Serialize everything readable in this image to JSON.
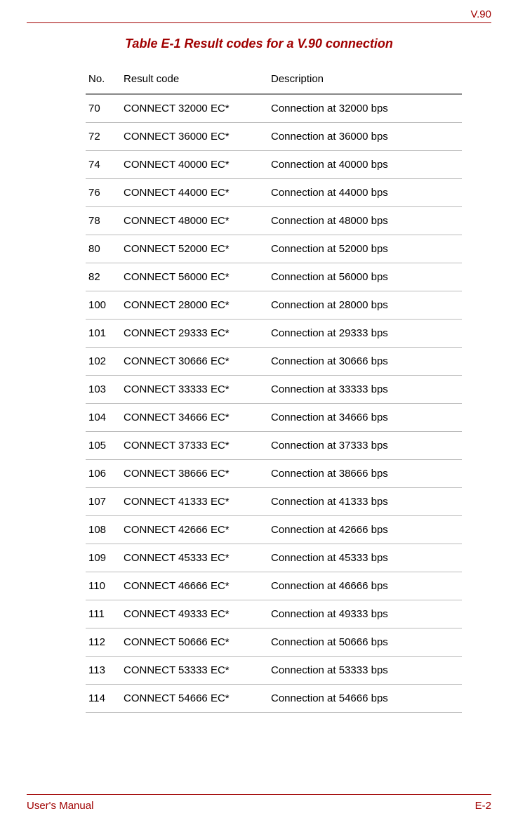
{
  "header": {
    "section": "V.90"
  },
  "table": {
    "title": "Table E-1 Result codes for a V.90 connection",
    "columns": {
      "no": "No.",
      "code": "Result code",
      "desc": "Description"
    },
    "rows": [
      {
        "no": "70",
        "code": "CONNECT 32000 EC*",
        "desc": "Connection at 32000 bps"
      },
      {
        "no": "72",
        "code": "CONNECT 36000 EC*",
        "desc": "Connection at 36000 bps"
      },
      {
        "no": "74",
        "code": "CONNECT 40000 EC*",
        "desc": "Connection at 40000 bps"
      },
      {
        "no": "76",
        "code": "CONNECT 44000 EC*",
        "desc": "Connection at 44000 bps"
      },
      {
        "no": "78",
        "code": "CONNECT 48000 EC*",
        "desc": "Connection at 48000 bps"
      },
      {
        "no": "80",
        "code": "CONNECT 52000 EC*",
        "desc": "Connection at 52000 bps"
      },
      {
        "no": "82",
        "code": "CONNECT 56000 EC*",
        "desc": "Connection at 56000 bps"
      },
      {
        "no": "100",
        "code": "CONNECT 28000 EC*",
        "desc": "Connection at 28000 bps"
      },
      {
        "no": "101",
        "code": "CONNECT 29333 EC*",
        "desc": "Connection at 29333 bps"
      },
      {
        "no": "102",
        "code": "CONNECT 30666 EC*",
        "desc": "Connection at 30666 bps"
      },
      {
        "no": "103",
        "code": "CONNECT 33333 EC*",
        "desc": "Connection at 33333 bps"
      },
      {
        "no": "104",
        "code": "CONNECT 34666 EC*",
        "desc": "Connection at 34666 bps"
      },
      {
        "no": "105",
        "code": "CONNECT 37333 EC*",
        "desc": "Connection at 37333 bps"
      },
      {
        "no": "106",
        "code": "CONNECT 38666 EC*",
        "desc": "Connection at 38666 bps"
      },
      {
        "no": "107",
        "code": "CONNECT 41333 EC*",
        "desc": "Connection at 41333 bps"
      },
      {
        "no": "108",
        "code": "CONNECT 42666 EC*",
        "desc": "Connection at 42666 bps"
      },
      {
        "no": "109",
        "code": "CONNECT 45333 EC*",
        "desc": "Connection at 45333 bps"
      },
      {
        "no": "110",
        "code": "CONNECT 46666 EC*",
        "desc": "Connection at 46666 bps"
      },
      {
        "no": "111",
        "code": "CONNECT 49333 EC*",
        "desc": "Connection at 49333 bps"
      },
      {
        "no": "112",
        "code": "CONNECT 50666 EC*",
        "desc": "Connection at 50666 bps"
      },
      {
        "no": "113",
        "code": "CONNECT 53333 EC*",
        "desc": "Connection at 53333 bps"
      },
      {
        "no": "114",
        "code": "CONNECT 54666 EC*",
        "desc": "Connection at 54666 bps"
      }
    ]
  },
  "footer": {
    "left": "User's Manual",
    "right": "E-2"
  }
}
